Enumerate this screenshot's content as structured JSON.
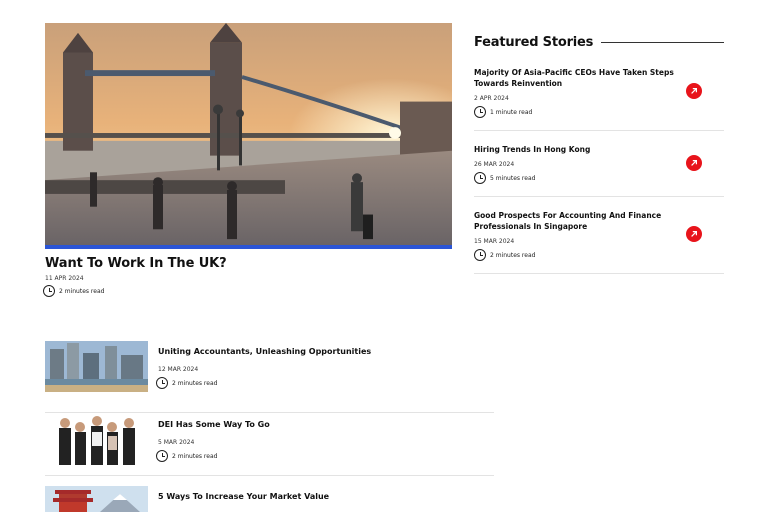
{
  "hero": {
    "title": "Want To Work In The UK?",
    "date": "11 APR 2024",
    "read_time": "2 minutes read",
    "image_alt": "Tower Bridge at sunset"
  },
  "featured": {
    "heading": "Featured Stories",
    "items": [
      {
        "title": "Majority Of Asia-Pacific CEOs Have Taken Steps Towards Reinvention",
        "date": "2 APR 2024",
        "read_time": "1 minute read"
      },
      {
        "title": "Hiring Trends In Hong Kong",
        "date": "26 MAR 2024",
        "read_time": "5 minutes read"
      },
      {
        "title": "Good Prospects For Accounting And Finance Professionals In Singapore",
        "date": "15 MAR 2024",
        "read_time": "2 minutes read"
      }
    ]
  },
  "list": [
    {
      "title": "Uniting Accountants, Unleashing Opportunities",
      "date": "12 MAR 2024",
      "read_time": "2 minutes read"
    },
    {
      "title": "DEI Has Some Way To Go",
      "date": "5 MAR 2024",
      "read_time": "2 minutes read"
    },
    {
      "title": "5 Ways To Increase Your Market Value",
      "date": "",
      "read_time": ""
    }
  ],
  "colors": {
    "accent_red": "#e8141b",
    "accent_blue": "#2b55d6"
  },
  "icons": {
    "clock": "clock-icon",
    "arrow": "arrow-up-right-icon"
  }
}
